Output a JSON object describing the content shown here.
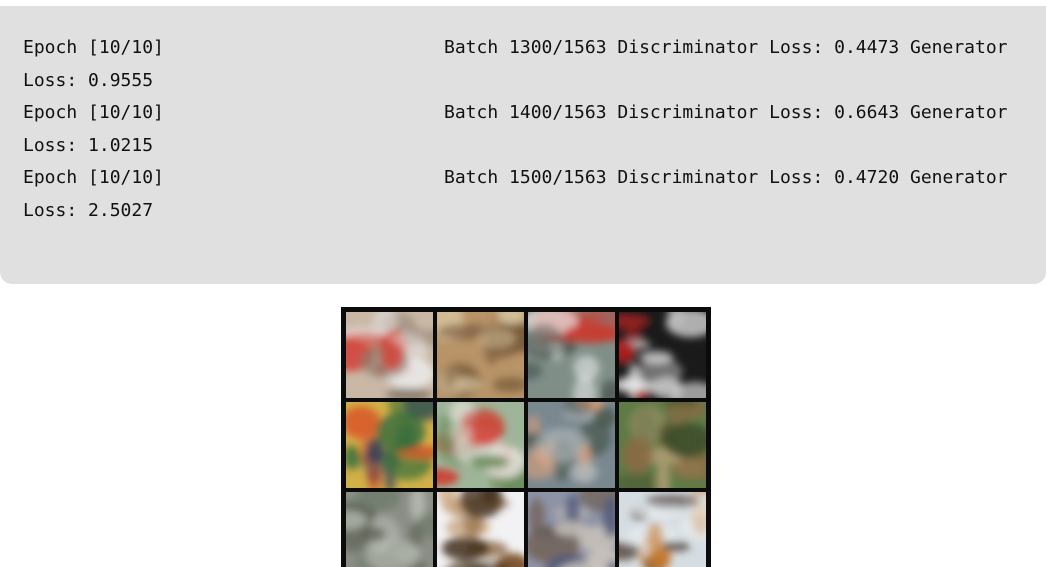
{
  "log": {
    "lines": [
      {
        "epoch": "Epoch [10/10]",
        "rest": "Batch 1300/1563 Discriminator Loss: 0.4473 Generator",
        "wrap": "Loss: 0.9555"
      },
      {
        "epoch": "Epoch [10/10]",
        "rest": "Batch 1400/1563 Discriminator Loss: 0.6643 Generator",
        "wrap": "Loss: 1.0215"
      },
      {
        "epoch": "Epoch [10/10]",
        "rest": "Batch 1500/1563 Discriminator Loss: 0.4720 Generator",
        "wrap": "Loss: 2.5027"
      }
    ]
  },
  "image_grid": {
    "rows": 3,
    "cols": 4,
    "tiles": [
      {
        "palette": [
          "#c9b8a6",
          "#d2453a",
          "#8b7a6b",
          "#eaeaea"
        ]
      },
      {
        "palette": [
          "#b89468",
          "#7a5a3a",
          "#d9c6a0",
          "#5a4026"
        ]
      },
      {
        "palette": [
          "#7f8f88",
          "#c93a2f",
          "#e8e8e8",
          "#3f4a44"
        ]
      },
      {
        "palette": [
          "#1a1a1a",
          "#e9e9e9",
          "#c2c2c2",
          "#b02020"
        ]
      },
      {
        "palette": [
          "#d2b048",
          "#1e3560",
          "#2f6b3a",
          "#d95a2a"
        ]
      },
      {
        "palette": [
          "#9fb59a",
          "#d62a22",
          "#6b8c5a",
          "#e6e3dc"
        ]
      },
      {
        "palette": [
          "#7a8890",
          "#d9a07a",
          "#4a5a50",
          "#b0b8bc"
        ]
      },
      {
        "palette": [
          "#5f7a46",
          "#8a6b44",
          "#3e4f2c",
          "#b7a47a"
        ]
      },
      {
        "palette": [
          "#8a8e86",
          "#5a5f52",
          "#b9bcb4",
          "#6e7a6a"
        ]
      },
      {
        "palette": [
          "#f2f2f4",
          "#7a4f26",
          "#3d2a18",
          "#c9a27a"
        ]
      },
      {
        "palette": [
          "#8e93a6",
          "#4f5878",
          "#c9c3bb",
          "#6c5a4c"
        ]
      },
      {
        "palette": [
          "#d6dde2",
          "#3b2a1c",
          "#c47a30",
          "#e9eef0"
        ]
      }
    ]
  }
}
